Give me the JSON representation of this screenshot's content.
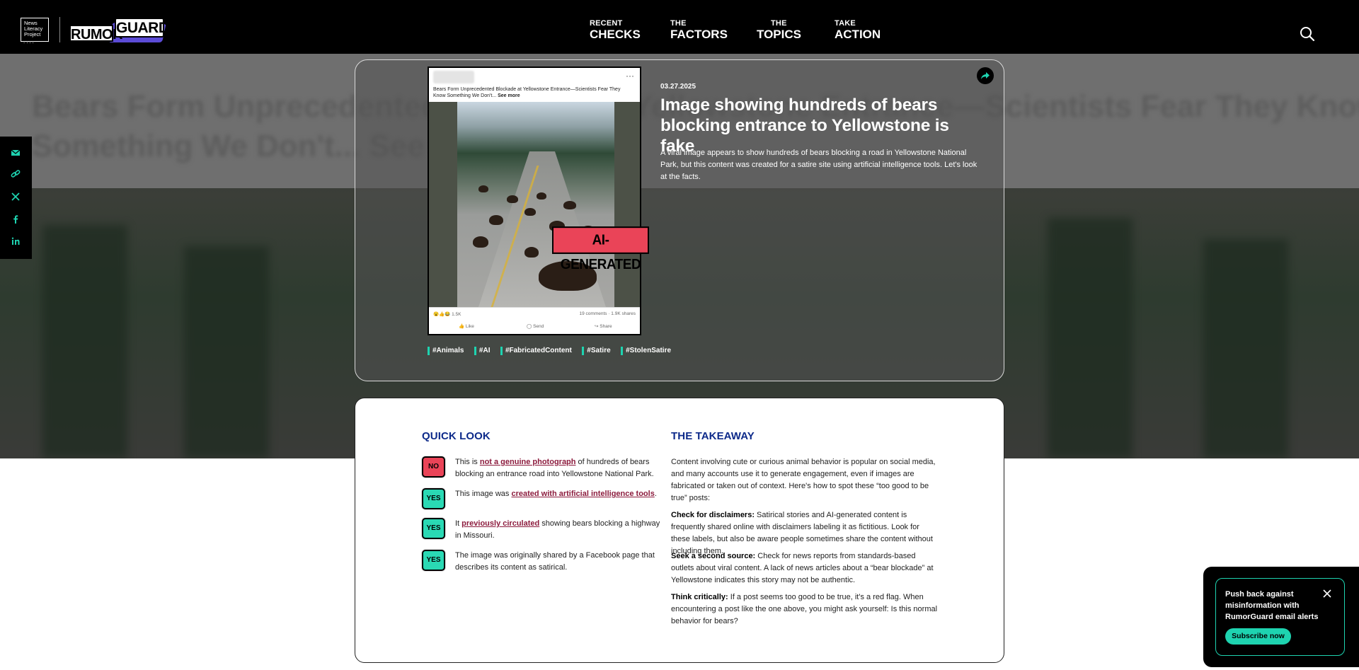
{
  "header": {
    "nlp_logo_lines": [
      "News",
      "Literacy",
      "Project"
    ],
    "rg_logo_rumor": "RUMOR",
    "rg_logo_guard": "GUARD",
    "nav": [
      {
        "small": "RECENT",
        "big": "CHECKS"
      },
      {
        "small": "THE",
        "big": "FACTORS"
      },
      {
        "small": "THE",
        "big": "TOPICS"
      },
      {
        "small": "TAKE",
        "big": "ACTION"
      }
    ],
    "search_icon": "search-icon"
  },
  "background": {
    "ghost_line1": "Bears Form Unprecedented Blockade at Yellowstone Entrance—Scientists Fear They Know",
    "ghost_line2": "Something We Don't... See more"
  },
  "share_sidebar": {
    "icons": [
      "email-icon",
      "link-icon",
      "x-icon",
      "facebook-icon",
      "linkedin-icon"
    ]
  },
  "post": {
    "caption": "Bears Form Unprecedented Blockade at Yellowstone Entrance—Scientists Fear They Know Something We Don't...",
    "see_more": "See more",
    "reactions": "1.5K",
    "counts": "19 comments · 1.9K shares",
    "actions": [
      "Like",
      "Send",
      "Share"
    ],
    "stamp": "AI-GENERATED"
  },
  "tags": [
    "#Animals",
    "#AI",
    "#FabricatedContent",
    "#Satire",
    "#StolenSatire"
  ],
  "article": {
    "date": "03.27.2025",
    "title": "Image showing hundreds of bears blocking entrance to Yellowstone is fake",
    "summary": "A viral image appears to show hundreds of bears blocking a road in Yellowstone National Park, but this content was created for a satire site using artificial intelligence tools. Let's look at the facts."
  },
  "quick_look": {
    "title": "QUICK LOOK",
    "items": [
      {
        "badge": "NO",
        "pre": "This is ",
        "link": "not a genuine photograph",
        "post": " of hundreds of bears blocking an entrance road into Yellowstone National Park."
      },
      {
        "badge": "YES",
        "pre": "This image was ",
        "link": "created with artificial intelligence tools",
        "post": "."
      },
      {
        "badge": "YES",
        "pre": "It ",
        "link": "previously circulated",
        "post": " showing bears blocking a highway in Missouri."
      },
      {
        "badge": "YES",
        "pre": "The image was originally shared by a Facebook page that describes its content as satirical.",
        "link": "",
        "post": ""
      }
    ]
  },
  "takeaway": {
    "title": "THE TAKEAWAY",
    "intro": "Content involving cute or curious animal behavior is popular on social media, and many accounts use it to generate engagement, even if images are fabricated or taken out of context. Here's how to spot these “too good to be true” posts:",
    "tips": [
      {
        "head": "Check for disclaimers:",
        "body": " Satirical stories and AI-generated content is frequently shared online with disclaimers labeling it as fictitious. Look for these labels, but also be aware people sometimes share the content without including them."
      },
      {
        "head": "Seek a second source:",
        "body": " Check for news reports from standards-based outlets about viral content. A lack of news articles about a “bear blockade” at Yellowstone indicates this story may not be authentic."
      },
      {
        "head": "Think critically:",
        "body": " If a post seems too good to be true, it's a red flag. When encountering a post like the one above, you might ask yourself: Is this normal behavior for bears?"
      }
    ]
  },
  "popup": {
    "text": "Push back against misinformation with RumorGuard email alerts",
    "button": "Subscribe now"
  },
  "colors": {
    "accent_teal": "#1ed3b0",
    "no_red": "#ea4458",
    "heading_blue": "#0d2a8a",
    "link_maroon": "#8c1b3d"
  }
}
